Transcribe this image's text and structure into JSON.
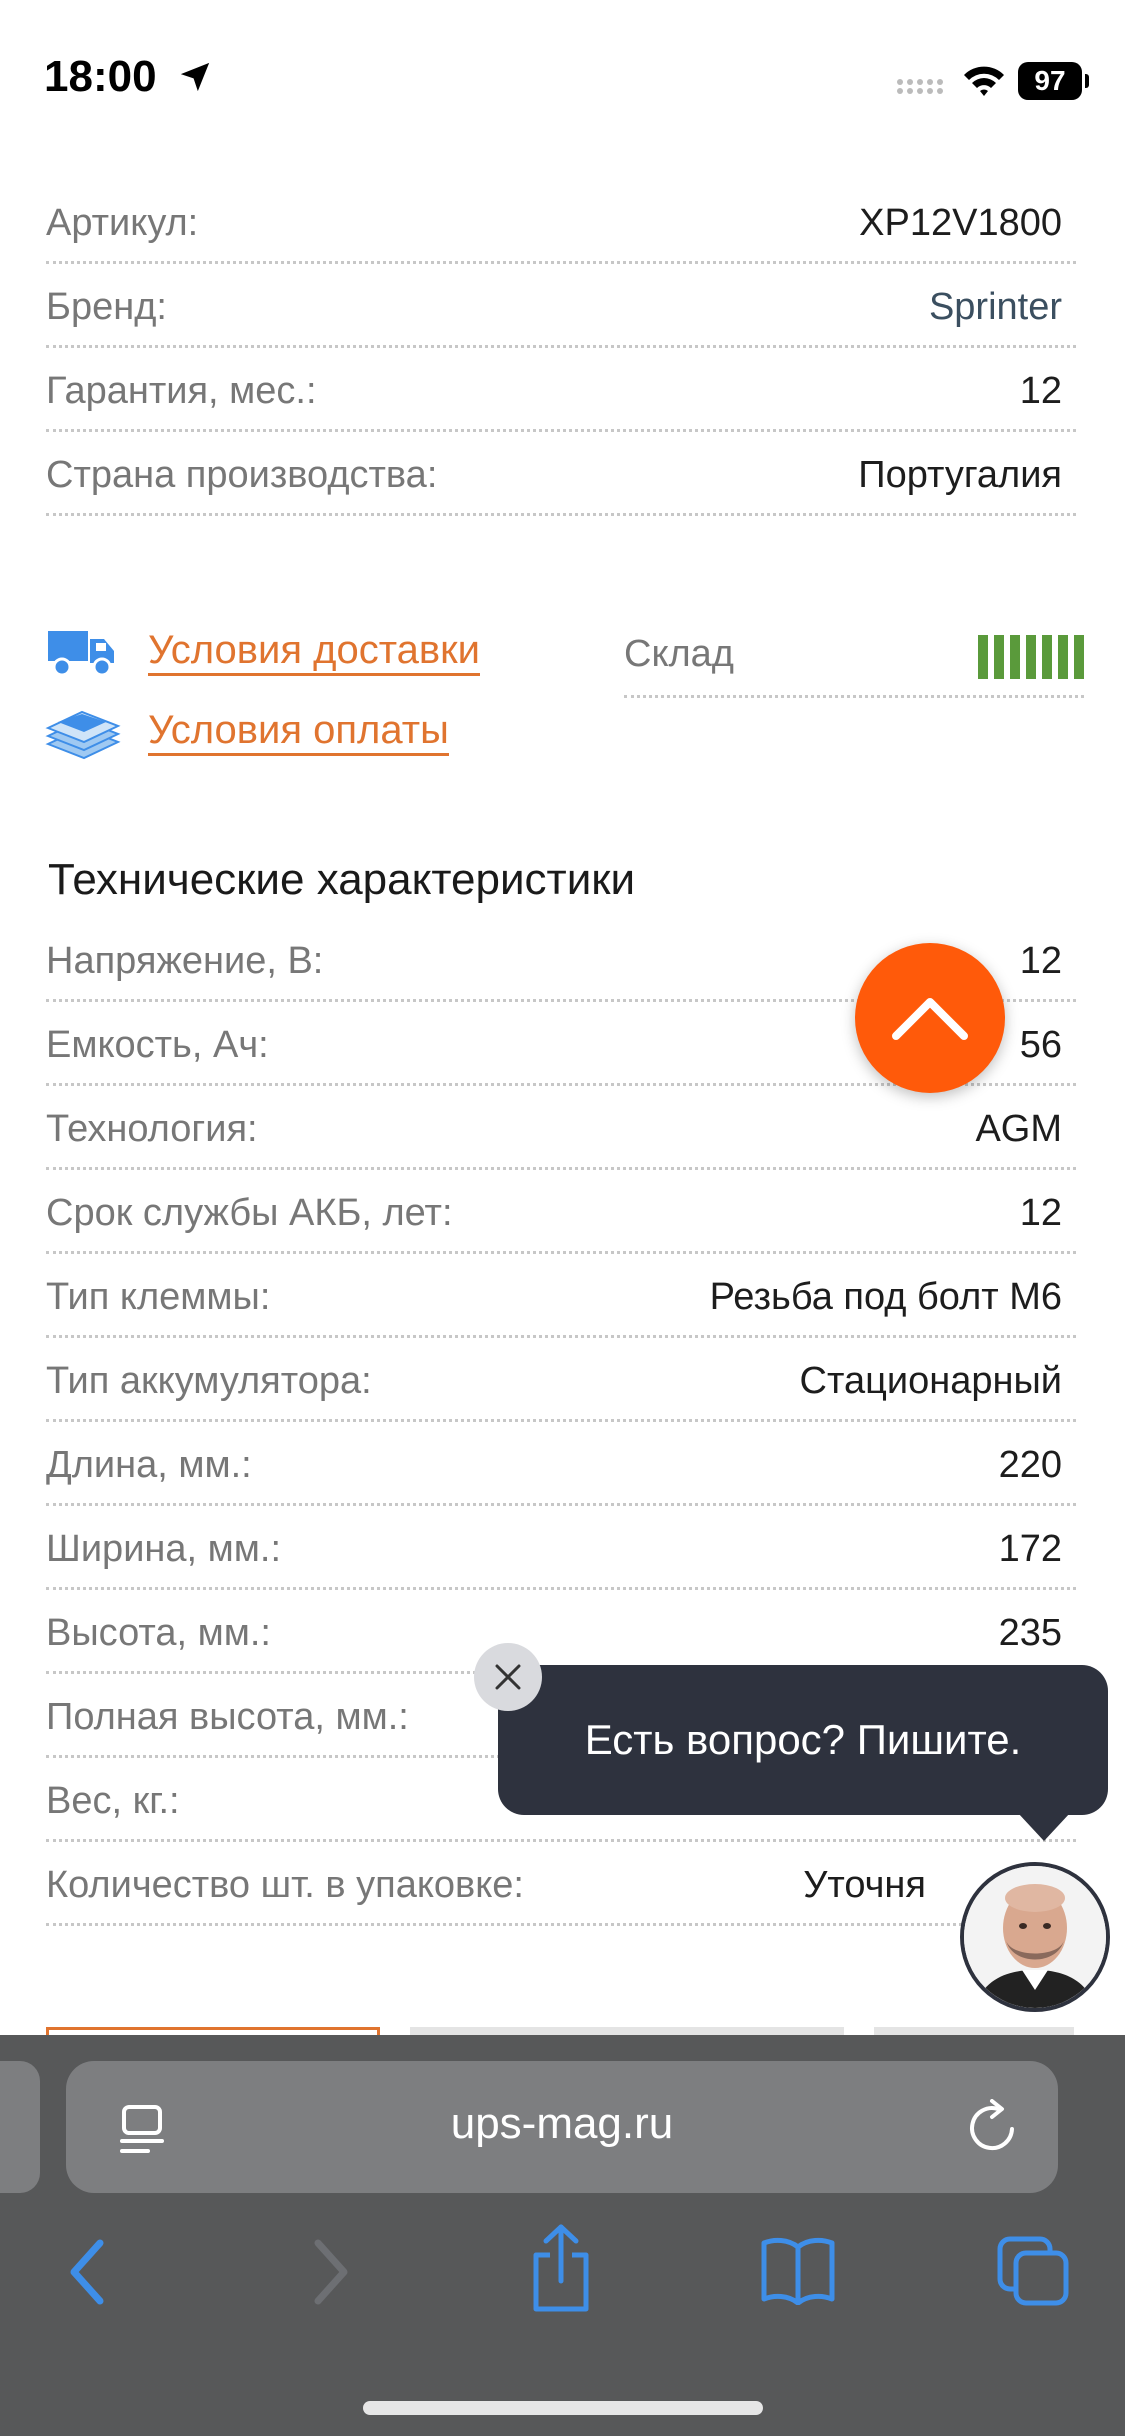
{
  "status_bar": {
    "time": "18:00",
    "battery": "97"
  },
  "product_info": [
    {
      "label": "Артикул:",
      "value": "XP12V1800"
    },
    {
      "label": "Бренд:",
      "value": "Sprinter"
    },
    {
      "label": "Гарантия, мес.:",
      "value": "12"
    },
    {
      "label": "Страна производства:",
      "value": "Португалия"
    }
  ],
  "delivery": {
    "delivery_link": "Условия доставки",
    "payment_link": "Условия оплаты",
    "stock_label": "Склад",
    "stock_level_bars": 7
  },
  "tech": {
    "title": "Технические характеристики",
    "rows": [
      {
        "label": "Напряжение, В:",
        "value": "12"
      },
      {
        "label": "Емкость, Ач:",
        "value": "56"
      },
      {
        "label": "Технология:",
        "value": "AGM"
      },
      {
        "label": "Срок службы АКБ, лет:",
        "value": "12"
      },
      {
        "label": "Тип клеммы:",
        "value": "Резьба под болт М6"
      },
      {
        "label": "Тип аккумулятора:",
        "value": "Стационарный"
      },
      {
        "label": "Длина, мм.:",
        "value": "220"
      },
      {
        "label": "Ширина, мм.:",
        "value": "172"
      },
      {
        "label": "Высота, мм.:",
        "value": "235"
      },
      {
        "label": "Полная высота, мм.:",
        "value": ""
      },
      {
        "label": "Вес, кг.:",
        "value": "–"
      },
      {
        "label": "Количество шт. в упаковке:",
        "value": "Уточня"
      }
    ]
  },
  "chat": {
    "message": "Есть вопрос? Пишите."
  },
  "browser": {
    "url": "ups-mag.ru"
  },
  "colors": {
    "accent": "#e0742f",
    "scroll_button": "#ff5a0a",
    "stock": "#5a9a3b",
    "chat_bg": "#2e323e",
    "toolbar_icon": "#3e8ee8"
  }
}
